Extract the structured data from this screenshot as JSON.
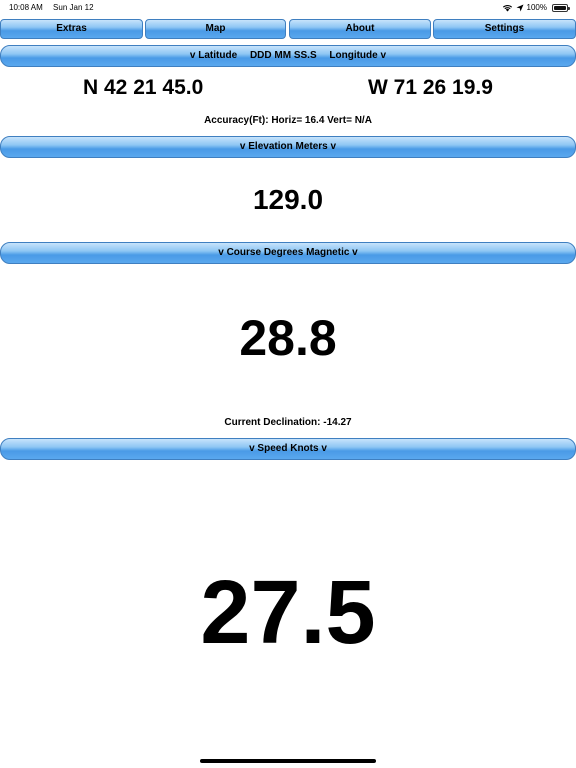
{
  "status_bar": {
    "time": "10:08 AM",
    "date": "Sun Jan 12",
    "battery": "100%",
    "icons": [
      "wifi-icon",
      "location-arrow-icon",
      "battery-icon"
    ]
  },
  "tabs": [
    "Extras",
    "Map",
    "About",
    "Settings"
  ],
  "position": {
    "bar_parts": [
      "v Latitude",
      "DDD MM SS.S",
      "Longitude v"
    ],
    "latitude": "N 42 21 45.0",
    "longitude": "W 71 26 19.9",
    "accuracy": "Accuracy(Ft): Horiz= 16.4 Vert= N/A"
  },
  "elevation": {
    "bar": "v Elevation Meters v",
    "value": "129.0"
  },
  "course": {
    "bar": "v Course Degrees Magnetic v",
    "value": "28.8",
    "declination": "Current Declination: -14.27"
  },
  "speed": {
    "bar": "v Speed Knots v",
    "value": "27.5"
  },
  "colors": {
    "bar_top": "#c7e3fb",
    "bar_bottom": "#4a9ae6",
    "bar_border": "#3f7fc0"
  }
}
